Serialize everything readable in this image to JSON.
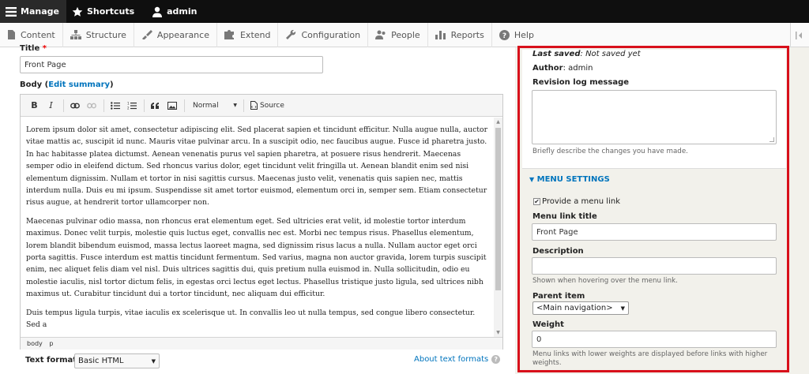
{
  "topbar": {
    "manage": "Manage",
    "shortcuts": "Shortcuts",
    "user": "admin"
  },
  "menu": {
    "content": "Content",
    "structure": "Structure",
    "appearance": "Appearance",
    "extend": "Extend",
    "configuration": "Configuration",
    "people": "People",
    "reports": "Reports",
    "help": "Help"
  },
  "form": {
    "title_label": "Title",
    "title_required": "*",
    "title_value": "Front Page",
    "body_label": "Body",
    "body_edit_summary": "Edit summary",
    "editor": {
      "bold": "B",
      "italic": "I",
      "format_value": "Normal",
      "source_label": "Source",
      "paragraphs": [
        "Lorem ipsum dolor sit amet, consectetur adipiscing elit. Sed placerat sapien et tincidunt efficitur. Nulla augue nulla, auctor vitae mattis ac, suscipit id nunc. Mauris vitae pulvinar arcu. In a suscipit odio, nec faucibus augue. Fusce id pharetra justo. In hac habitasse platea dictumst. Aenean venenatis purus vel sapien pharetra, at posuere risus hendrerit. Maecenas semper odio in eleifend dictum. Sed rhoncus varius dolor, eget tincidunt velit fringilla ut. Aenean blandit enim sed nisi elementum dignissim. Nullam et tortor in nisi sagittis cursus. Maecenas justo velit, venenatis quis sapien nec, mattis interdum nulla. Duis eu mi ipsum. Suspendisse sit amet tortor euismod, elementum orci in, semper sem. Etiam consectetur risus augue, at hendrerit tortor ullamcorper non.",
        "Maecenas pulvinar odio massa, non rhoncus erat elementum eget. Sed ultricies erat velit, id molestie tortor interdum maximus. Donec velit turpis, molestie quis luctus eget, convallis nec est. Morbi nec tempus risus. Phasellus elementum, lorem blandit bibendum euismod, massa lectus laoreet magna, sed dignissim risus lacus a nulla. Nullam auctor eget orci porta sagittis. Fusce interdum est mattis tincidunt fermentum. Sed varius, magna non auctor gravida, lorem turpis suscipit enim, nec aliquet felis diam vel nisl. Duis ultrices sagittis dui, quis pretium nulla euismod in. Nulla sollicitudin, odio eu molestie iaculis, nisl tortor dictum felis, in egestas orci lectus eget lectus. Phasellus tristique justo ligula, sed ultrices nibh maximus ut. Curabitur tincidunt dui a tortor tincidunt, nec aliquam dui efficitur.",
        "Duis tempus ligula turpis, vitae iaculis ex scelerisque ut. In convallis leo ut nulla tempus, sed congue libero consectetur. Sed a"
      ],
      "path_body": "body",
      "path_p": "p"
    },
    "text_format_label": "Text format",
    "text_format_value": "Basic HTML",
    "about_text_formats": "About text formats"
  },
  "sidebar": {
    "last_saved_label": "Last saved",
    "last_saved_value": "Not saved yet",
    "author_label": "Author",
    "author_value": "admin",
    "revision_label": "Revision log message",
    "revision_desc": "Briefly describe the changes you have made.",
    "menu_settings_title": "MENU SETTINGS",
    "provide_menu_link": "Provide a menu link",
    "menu_link_title_label": "Menu link title",
    "menu_link_title_value": "Front Page",
    "description_label": "Description",
    "description_desc": "Shown when hovering over the menu link.",
    "parent_item_label": "Parent item",
    "parent_item_value": "<Main navigation>",
    "weight_label": "Weight",
    "weight_value": "0",
    "weight_desc": "Menu links with lower weights are displayed before links with higher weights."
  },
  "colors": {
    "highlight_border": "#d8101b",
    "link": "#0074bd"
  }
}
